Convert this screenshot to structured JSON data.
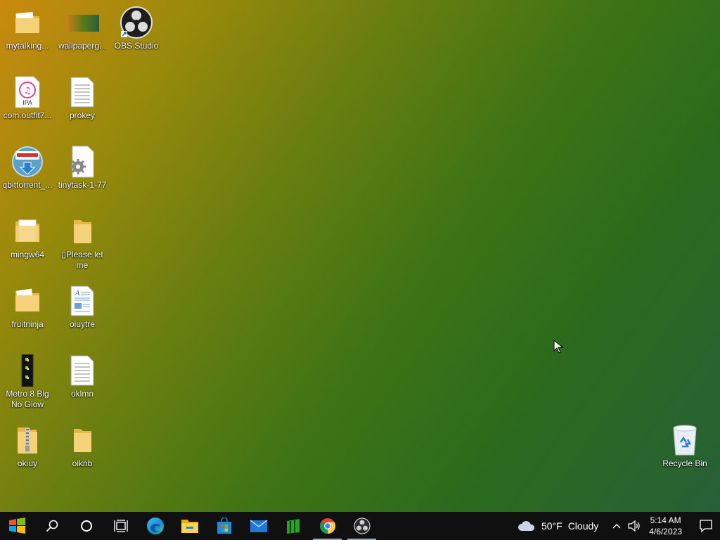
{
  "desktop": {
    "icons": [
      {
        "label": "mytalking...",
        "icon": "folder-icon"
      },
      {
        "label": "wallpaperg...",
        "icon": "image-file-icon"
      },
      {
        "label": "OBS Studio",
        "icon": "obs-studio-icon"
      },
      {
        "label": "com.outfit7...",
        "icon": "ipa-file-icon"
      },
      {
        "label": "prokey",
        "icon": "text-file-icon"
      },
      {
        "label": "qbittorrent_...",
        "icon": "qbittorrent-installer-icon"
      },
      {
        "label": "tinytask-1-77",
        "icon": "settings-file-icon"
      },
      {
        "label": "mingw64",
        "icon": "folder-icon"
      },
      {
        "label": "▯Please let me",
        "icon": "folder-icon"
      },
      {
        "label": "fruitninja",
        "icon": "folder-icon"
      },
      {
        "label": "oiuytre",
        "icon": "document-file-icon"
      },
      {
        "label": "Metro 8 Big No Glow",
        "icon": "metro-theme-icon"
      },
      {
        "label": "oklmn",
        "icon": "text-file-icon"
      },
      {
        "label": "okiuy",
        "icon": "zip-folder-icon"
      },
      {
        "label": "oiknb",
        "icon": "folder-icon"
      },
      {
        "label": "Recycle Bin",
        "icon": "recycle-bin-icon"
      }
    ]
  },
  "taskbar": {
    "apps": [
      "start",
      "search",
      "cortana",
      "task-view",
      "edge",
      "file-explorer",
      "microsoft-store",
      "mail",
      "app-green",
      "chrome",
      "obs-studio"
    ],
    "weather": {
      "temp": "50°F",
      "condition": "Cloudy"
    },
    "time": "5:14 AM",
    "date": "4/6/2023"
  },
  "colors": {
    "taskbar": "#101010",
    "accent": "#0078d7"
  }
}
